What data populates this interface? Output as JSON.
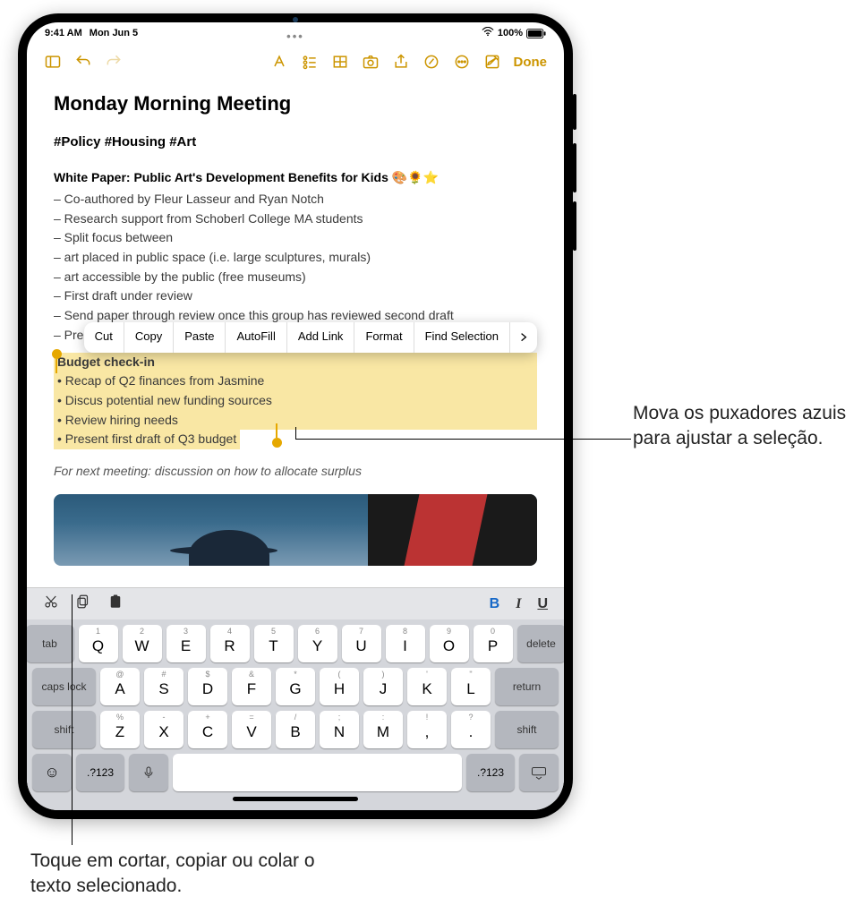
{
  "status": {
    "time": "9:41 AM",
    "date": "Mon Jun 5",
    "battery": "100%",
    "charging": "☑"
  },
  "toolbar": {
    "done": "Done"
  },
  "note": {
    "title": "Monday Morning Meeting",
    "tags": "#Policy #Housing #Art",
    "subhead": "White Paper: Public Art's Development Benefits for Kids",
    "emoji": "🎨🌻⭐",
    "lines": [
      "– Co-authored by Fleur Lasseur and Ryan Notch",
      "– Research support from Schoberl College MA students",
      "– Split focus between",
      "– art placed in public space (i.e. large sculptures, murals)",
      "– art accessible by the public (free museums)",
      "– First draft under review",
      "– Send paper through review once this group has reviewed second draft",
      "– Pres"
    ],
    "selection": {
      "head": "Budget check-in",
      "items": [
        "• Recap of Q2 finances from Jasmine",
        "• Discus potential new funding sources",
        "• Review hiring needs",
        "• Present first draft of Q3 budget"
      ]
    },
    "italic": "For next meeting: discussion on how to allocate surplus"
  },
  "context_menu": [
    "Cut",
    "Copy",
    "Paste",
    "AutoFill",
    "Add Link",
    "Format",
    "Find Selection"
  ],
  "kb_shortcut": {
    "bold": "B",
    "italic": "I",
    "underline": "U"
  },
  "keyboard": {
    "row1": [
      {
        "alt": "1",
        "main": "Q"
      },
      {
        "alt": "2",
        "main": "W"
      },
      {
        "alt": "3",
        "main": "E"
      },
      {
        "alt": "4",
        "main": "R"
      },
      {
        "alt": "5",
        "main": "T"
      },
      {
        "alt": "6",
        "main": "Y"
      },
      {
        "alt": "7",
        "main": "U"
      },
      {
        "alt": "8",
        "main": "I"
      },
      {
        "alt": "9",
        "main": "O"
      },
      {
        "alt": "0",
        "main": "P"
      }
    ],
    "row2": [
      {
        "alt": "@",
        "main": "A"
      },
      {
        "alt": "#",
        "main": "S"
      },
      {
        "alt": "$",
        "main": "D"
      },
      {
        "alt": "&",
        "main": "F"
      },
      {
        "alt": "*",
        "main": "G"
      },
      {
        "alt": "(",
        "main": "H"
      },
      {
        "alt": ")",
        "main": "J"
      },
      {
        "alt": "'",
        "main": "K"
      },
      {
        "alt": "\"",
        "main": "L"
      }
    ],
    "row3": [
      {
        "alt": "%",
        "main": "Z"
      },
      {
        "alt": "-",
        "main": "X"
      },
      {
        "alt": "+",
        "main": "C"
      },
      {
        "alt": "=",
        "main": "V"
      },
      {
        "alt": "/",
        "main": "B"
      },
      {
        "alt": ";",
        "main": "N"
      },
      {
        "alt": ":",
        "main": "M"
      },
      {
        "alt": "!",
        "main": ","
      },
      {
        "alt": "?",
        "main": "."
      }
    ],
    "tab": "tab",
    "delete": "delete",
    "caps": "caps lock",
    "return": "return",
    "shift": "shift",
    "numkey": ".?123"
  },
  "callouts": {
    "c1": "Mova os puxadores azuis para ajustar a seleção.",
    "c2": "Toque em cortar, copiar ou colar o texto selecionado."
  }
}
